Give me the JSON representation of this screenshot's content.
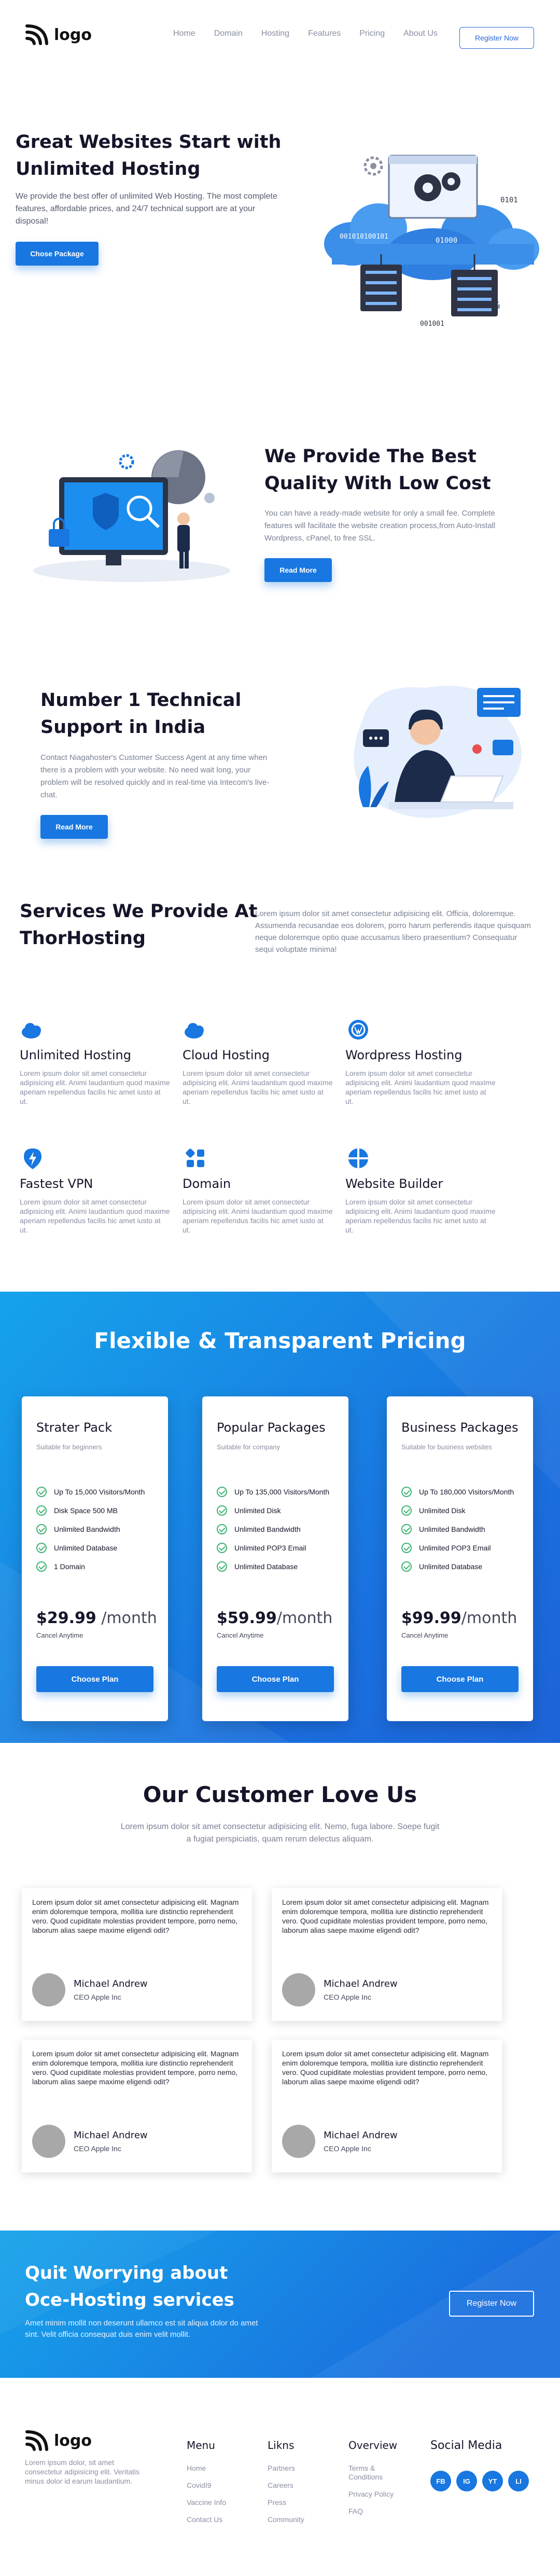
{
  "brand": {
    "name": "logo"
  },
  "nav": {
    "items": [
      "Home",
      "Domain",
      "Hosting",
      "Features",
      "Pricing",
      "About Us"
    ],
    "register_label": "Register Now"
  },
  "hero": {
    "title": "Great Websites Start with Unlimited Hosting",
    "text": "We provide the best offer of unlimited Web Hosting. The most complete features, affordable prices, and 24/7 technical support are at your disposal!",
    "button": "Chose Package",
    "ill_code_1": "0101",
    "ill_code_2": "001010100101",
    "ill_code_3": "01000",
    "ill_code_4": "001001"
  },
  "quality": {
    "title": "We Provide The Best Quality With Low Cost",
    "text": "You can have a ready-made website for only a small fee. Complete features will facilitate the website creation process,from Auto-Install Wordpress, cPanel, to free SSL.",
    "button": "Read More"
  },
  "support": {
    "title": "Number 1 Technical Support in India",
    "text": "Contact Niagahoster's Customer Success Agent at any time when there is a problem with your website. No need wait long, your problem will be resolved quickly and in real-time via Intecom's live-chat.",
    "button": "Read More"
  },
  "services": {
    "title": "Services We Provide At ThorHosting",
    "text": "Lorem ipsum dolor sit amet consectetur adipisicing elit. Officia, doloremque. Assumenda recusandae eos dolorem, porro harum perferendis itaque quisquam neque doloremque optio quae accusamus libero praesentium? Consequatur sequi voluptate minima!",
    "items": [
      {
        "name": "Unlimited Hosting",
        "icon": "cloud-icon",
        "desc": "Lorem ipsum dolor sit amet consectetur adipisicing elit. Animi laudantium quod maxime aperiam repellendus facilis hic amet iusto at ut."
      },
      {
        "name": "Cloud Hosting",
        "icon": "cloud-icon",
        "desc": "Lorem ipsum dolor sit amet consectetur adipisicing elit. Animi laudantium quod maxime aperiam repellendus facilis hic amet iusto at ut."
      },
      {
        "name": "Wordpress Hosting",
        "icon": "wordpress-icon",
        "desc": "Lorem ipsum dolor sit amet consectetur adipisicing elit. Animi laudantium quod maxime aperiam repellendus facilis hic amet iusto at ut."
      },
      {
        "name": "Fastest VPN",
        "icon": "bolt-icon",
        "desc": "Lorem ipsum dolor sit amet consectetur adipisicing elit. Animi laudantium quod maxime aperiam repellendus facilis hic amet iusto at ut."
      },
      {
        "name": "Domain",
        "icon": "grid-icon",
        "desc": "Lorem ipsum dolor sit amet consectetur adipisicing elit. Animi laudantium quod maxime aperiam repellendus facilis hic amet iusto at ut."
      },
      {
        "name": "Website Builder",
        "icon": "pie-icon",
        "desc": "Lorem ipsum dolor sit amet consectetur adipisicing elit. Animi laudantium quod maxime aperiam repellendus facilis hic amet iusto at ut."
      }
    ]
  },
  "pricing": {
    "title": "Flexible & Transparent Pricing",
    "plans": [
      {
        "name": "Strater Pack",
        "sub": "Suitable for beginners",
        "features": [
          "Up To 15,000 Visitors/Month",
          "Disk Space 500 MB",
          "Unlimited Bandwidth",
          "Unlimited Database",
          "1 Domain"
        ],
        "price": "$29.99",
        "period": "/month",
        "cancel": "Cancel Anytime",
        "button": "Choose Plan"
      },
      {
        "name": "Popular Packages",
        "sub": "Suitable for company",
        "features": [
          "Up To 135,000 Visitors/Month",
          "Unlimited Disk",
          "Unlimited Bandwidth",
          "Unlimited POP3 Email",
          "Unlimited Database"
        ],
        "price": "$59.99",
        "period": "/month",
        "cancel": "Cancel Anytime",
        "button": "Choose Plan"
      },
      {
        "name": "Business Packages",
        "sub": "Suitable for business websites",
        "features": [
          "Up To 180,000 Visitors/Month",
          "Unlimited Disk",
          "Unlimited Bandwidth",
          "Unlimited POP3 Email",
          "Unlimited Database"
        ],
        "price": "$99.99",
        "period": "/month",
        "cancel": "Cancel Anytime",
        "button": "Choose Plan"
      }
    ]
  },
  "testimonials": {
    "title": "Our Customer Love Us",
    "sub": "Lorem ipsum dolor sit amet consectetur adipisicing elit. Nemo, fuga labore. Soepe fugit a fugiat perspiciatis, quam rerum delectus aliquam.",
    "items": [
      {
        "text": "Lorem ipsum dolor sit amet consectetur adipisicing elit. Magnam enim doloremque tempora, mollitia iure distinctio reprehenderit vero. Quod cupiditate molestias provident tempore, porro nemo, laborum alias saepe maxime eligendi odit?",
        "name": "Michael Andrew",
        "role": "CEO Apple Inc"
      },
      {
        "text": "Lorem ipsum dolor sit amet consectetur adipisicing elit. Magnam enim doloremque tempora, mollitia iure distinctio reprehenderit vero. Quod cupiditate molestias provident tempore, porro nemo, laborum alias saepe maxime eligendi odit?",
        "name": "Michael Andrew",
        "role": "CEO Apple Inc"
      },
      {
        "text": "Lorem ipsum dolor sit amet consectetur adipisicing elit. Magnam enim doloremque tempora, mollitia iure distinctio reprehenderit vero. Quod cupiditate molestias provident tempore, porro nemo, laborum alias saepe maxime eligendi odit?",
        "name": "Michael Andrew",
        "role": "CEO Apple Inc"
      },
      {
        "text": "Lorem ipsum dolor sit amet consectetur adipisicing elit. Magnam enim doloremque tempora, mollitia iure distinctio reprehenderit vero. Quod cupiditate molestias provident tempore, porro nemo, laborum alias saepe maxime eligendi odit?",
        "name": "Michael Andrew",
        "role": "CEO Apple Inc"
      }
    ]
  },
  "cta": {
    "title": "Quit Worrying about Oce-Hosting services",
    "text": "Amet minim mollit non deserunt ullamco est sit aliqua dolor do amet sint. Velit officia consequat duis enim velit mollit.",
    "button": "Register Now"
  },
  "footer": {
    "about": "Lorem ipsum dolor, sit amet consectetur adipisicing elit. Veritatis minus dolor id earum laudantium.",
    "columns": [
      {
        "title": "Menu",
        "items": [
          "Home",
          "CovidI9",
          "Vaccine Info",
          "Contact Us"
        ]
      },
      {
        "title": "Likns",
        "items": [
          "Partners",
          "Careers",
          "Press",
          "Community"
        ]
      },
      {
        "title": "Overview",
        "items": [
          "Terms & Conditions",
          "Privacy Policy",
          "FAQ"
        ]
      }
    ],
    "social_title": "Social Media",
    "social": [
      "FB",
      "IG",
      "YT",
      "LI"
    ]
  },
  "colors": {
    "accent": "#1877e0",
    "gradient_start": "#16a3ea",
    "gradient_end": "#1d63d8",
    "check": "#3cb371"
  }
}
